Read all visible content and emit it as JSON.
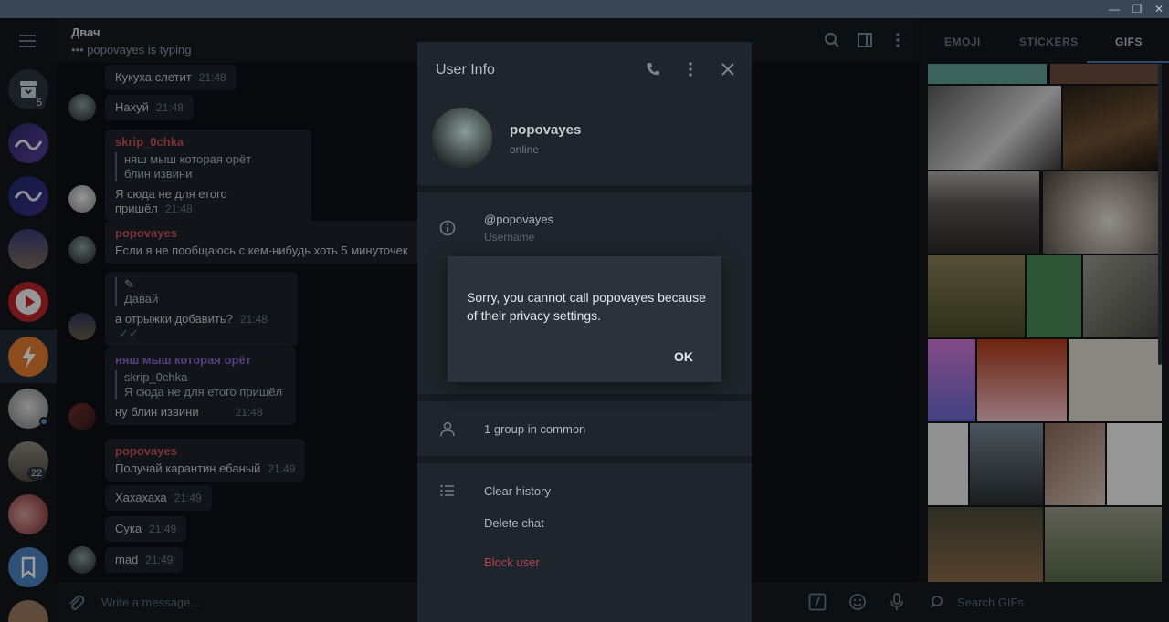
{
  "window": {
    "minimize": "—",
    "restore": "❐",
    "close": "✕"
  },
  "rail": {
    "badges": {
      "archive": "5",
      "chat_22": "22"
    }
  },
  "chat": {
    "title": "Двач",
    "status": "••• popovayes is typing",
    "composer_placeholder": "Write a message...",
    "messages": [
      {
        "text": "Кукуха слетит",
        "time": "21:48"
      },
      {
        "text": "Нахуй",
        "time": "21:48"
      },
      {
        "name": "skrip_0chka",
        "quote": [
          "няш мыш которая орёт",
          "блин извини"
        ],
        "text": "Я сюда не для етого пришёл",
        "time": "21:48"
      },
      {
        "name": "popovayes",
        "text": "Если я не пообщаюсь с кем-нибудь хоть 5 минуточек"
      },
      {
        "quote_icon": "✎",
        "quote": [
          "Давай"
        ],
        "text": "а отрыжки добавить?",
        "time": "21:48",
        "ticks": "✓✓"
      },
      {
        "name": "няш мыш которая орёт",
        "quote": [
          "skrip_0chka",
          "Я сюда не для етого пришёл"
        ],
        "text": "ну блин извини",
        "time": "21:48"
      },
      {
        "name": "popovayes",
        "text": "Получай карантин ебаный",
        "time": "21:49"
      },
      {
        "text": "Хахахаха",
        "time": "21:49"
      },
      {
        "text": "Сука",
        "time": "21:49"
      },
      {
        "text": "mad",
        "time": "21:49"
      }
    ]
  },
  "right_panel": {
    "tabs": [
      "EMOJI",
      "STICKERS",
      "GIFS"
    ],
    "search_placeholder": "Search GIFs"
  },
  "user_info": {
    "title": "User Info",
    "name": "popovayes",
    "status": "online",
    "username": "@popovayes",
    "username_label": "Username",
    "groups_in_common": "1 group in common",
    "clear_history": "Clear history",
    "delete_chat": "Delete chat",
    "block_user": "Block user"
  },
  "dialog": {
    "message": "Sorry, you cannot call popovayes because of their privacy settings.",
    "ok": "OK"
  },
  "colors": {
    "accent": "#4b7ab0",
    "name_red": "#c34f55",
    "name_purple": "#8a63c9",
    "danger": "#b3474d"
  }
}
